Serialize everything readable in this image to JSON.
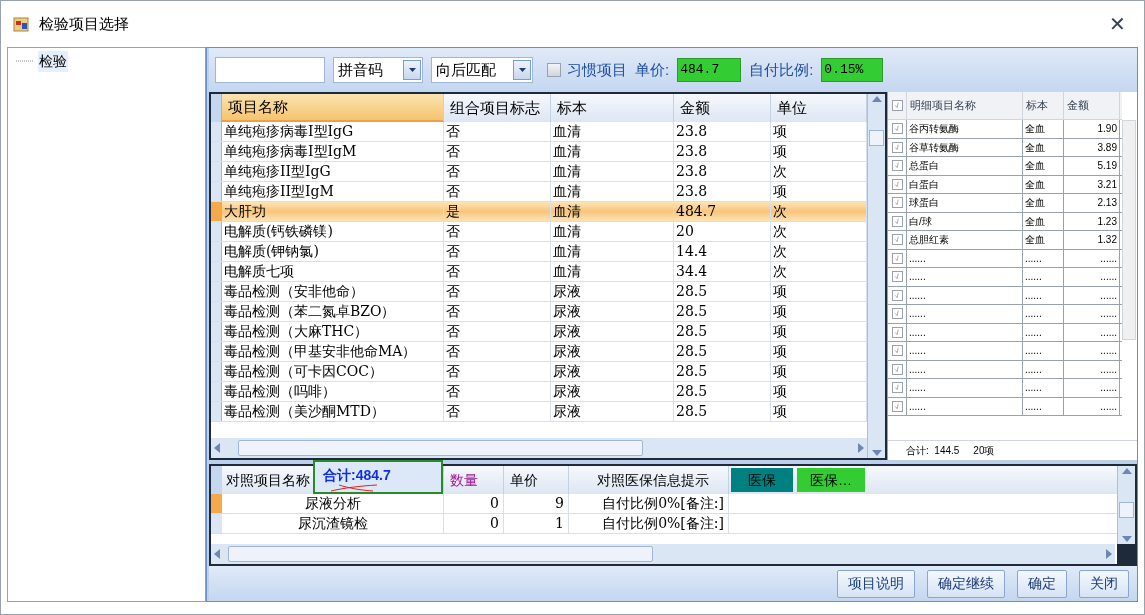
{
  "window": {
    "title": "检验项目选择",
    "close": "✕"
  },
  "tree": [
    {
      "label": "检验",
      "selected": true
    }
  ],
  "toolbar": {
    "pinyin": "拼音码",
    "match": "向后匹配",
    "habit": {
      "label": "习惯项目",
      "checked": false
    },
    "price_label": "单价:",
    "price": "484.7",
    "ratio_label": "自付比例:",
    "ratio": "0.15%"
  },
  "main_table": {
    "columns": [
      "项目名称",
      "组合项目标志",
      "标本",
      "金额",
      "单位"
    ],
    "rows": [
      {
        "cells": [
          "单纯疱疹病毒I型IgG",
          "否",
          "血清",
          "23.8",
          "项"
        ],
        "selected": false
      },
      {
        "cells": [
          "单纯疱疹病毒I型IgM",
          "否",
          "血清",
          "23.8",
          "项"
        ],
        "selected": false
      },
      {
        "cells": [
          "单纯疱疹II型IgG",
          "否",
          "血清",
          "23.8",
          "次"
        ],
        "selected": false
      },
      {
        "cells": [
          "单纯疱疹II型IgM",
          "否",
          "血清",
          "23.8",
          "项"
        ],
        "selected": false
      },
      {
        "cells": [
          "大肝功",
          "是",
          "血清",
          "484.7",
          "次"
        ],
        "selected": true
      },
      {
        "cells": [
          "电解质(钙铁磷镁)",
          "否",
          "血清",
          "20",
          "次"
        ],
        "selected": false
      },
      {
        "cells": [
          "电解质(钾钠氯)",
          "否",
          "血清",
          "14.4",
          "次"
        ],
        "selected": false
      },
      {
        "cells": [
          "电解质七项",
          "否",
          "血清",
          "34.4",
          "次"
        ],
        "selected": false
      },
      {
        "cells": [
          "毒品检测（安非他命）",
          "否",
          "尿液",
          "28.5",
          "项"
        ],
        "selected": false
      },
      {
        "cells": [
          "毒品检测（苯二氮卓BZO）",
          "否",
          "尿液",
          "28.5",
          "项"
        ],
        "selected": false
      },
      {
        "cells": [
          "毒品检测（大麻THC）",
          "否",
          "尿液",
          "28.5",
          "项"
        ],
        "selected": false
      },
      {
        "cells": [
          "毒品检测（甲基安非他命MA）",
          "否",
          "尿液",
          "28.5",
          "项"
        ],
        "selected": false
      },
      {
        "cells": [
          "毒品检测（可卡因COC）",
          "否",
          "尿液",
          "28.5",
          "项"
        ],
        "selected": false
      },
      {
        "cells": [
          "毒品检测（吗啡）",
          "否",
          "尿液",
          "28.5",
          "项"
        ],
        "selected": false
      },
      {
        "cells": [
          "毒品检测（美沙酮MTD）",
          "否",
          "尿液",
          "28.5",
          "项"
        ],
        "selected": false
      }
    ]
  },
  "detail_table": {
    "header_checked": true,
    "columns": [
      "明细项目名称",
      "标本",
      "金额"
    ],
    "rows": [
      {
        "cells": [
          "谷丙转氨酶",
          "全血",
          "1.90"
        ],
        "checked": true
      },
      {
        "cells": [
          "谷草转氨酶",
          "全血",
          "3.89"
        ],
        "checked": true
      },
      {
        "cells": [
          "总蛋白",
          "全血",
          "5.19"
        ],
        "checked": true
      },
      {
        "cells": [
          "白蛋白",
          "全血",
          "3.21"
        ],
        "checked": true
      },
      {
        "cells": [
          "球蛋白",
          "全血",
          "2.13"
        ],
        "checked": true
      },
      {
        "cells": [
          "白/球",
          "全血",
          "1.23"
        ],
        "checked": true
      },
      {
        "cells": [
          "总胆红素",
          "全血",
          "1.32"
        ],
        "checked": true
      },
      {
        "cells": [
          "......",
          "......",
          "......"
        ],
        "checked": true
      },
      {
        "cells": [
          "......",
          "......",
          "......"
        ],
        "checked": true
      },
      {
        "cells": [
          "......",
          "......",
          "......"
        ],
        "checked": true
      },
      {
        "cells": [
          "......",
          "......",
          "......"
        ],
        "checked": true
      },
      {
        "cells": [
          "......",
          "......",
          "......"
        ],
        "checked": true
      },
      {
        "cells": [
          "......",
          "......",
          "......"
        ],
        "checked": true
      },
      {
        "cells": [
          "......",
          "......",
          "......"
        ],
        "checked": true
      },
      {
        "cells": [
          "......",
          "......",
          "......"
        ],
        "checked": true
      },
      {
        "cells": [
          "......",
          "......",
          "......"
        ],
        "checked": true
      }
    ],
    "total": "合计:  144.5",
    "count": "20项"
  },
  "lower_table": {
    "columns": [
      "对照项目名称",
      "数量",
      "单价",
      "对照医保信息提示"
    ],
    "badges": [
      {
        "label": "医保",
        "color": "#008080"
      },
      {
        "label": "医保…",
        "color": "#33cc33"
      }
    ],
    "total": "合计:484.7",
    "rows": [
      {
        "cells": [
          "尿液分析",
          "0",
          "9",
          "自付比例0%[备注:]"
        ]
      },
      {
        "cells": [
          "尿沉渣镜检",
          "0",
          "1",
          "自付比例0%[备注:]"
        ]
      }
    ]
  },
  "buttons": [
    "项目说明",
    "确定继续",
    "确定",
    "关闭"
  ]
}
